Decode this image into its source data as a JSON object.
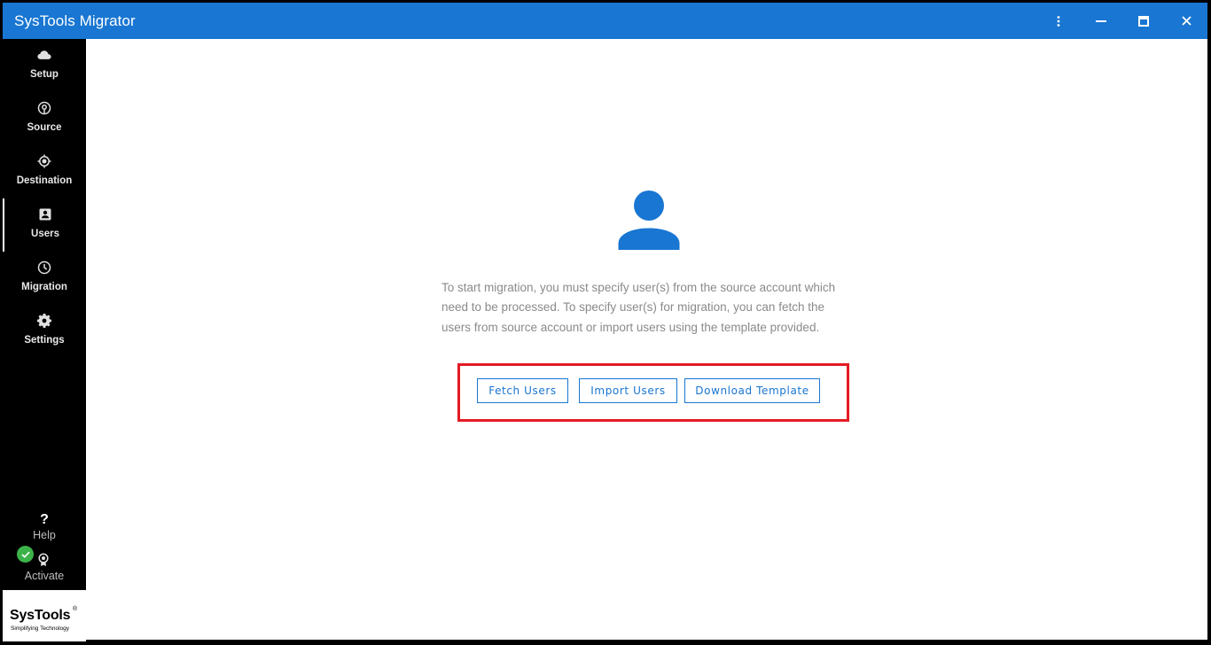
{
  "app": {
    "title": "SysTools Migrator"
  },
  "window_controls": {
    "more": "more-vert-icon",
    "minimize": "minimize-icon",
    "maximize": "maximize-icon",
    "close": "close-icon"
  },
  "sidebar": {
    "items": [
      {
        "label": "Setup",
        "icon": "cloud-icon"
      },
      {
        "label": "Source",
        "icon": "source-icon"
      },
      {
        "label": "Destination",
        "icon": "destination-icon"
      },
      {
        "label": "Users",
        "icon": "users-icon",
        "active": true
      },
      {
        "label": "Migration",
        "icon": "clock-icon"
      },
      {
        "label": "Settings",
        "icon": "gear-icon"
      }
    ],
    "help": {
      "symbol": "?",
      "label": "Help"
    },
    "activate": {
      "label": "Activate"
    },
    "logo": {
      "brand": "SysTools",
      "reg": "®",
      "tagline": "Simplifying Technology"
    }
  },
  "main": {
    "description": "To start migration, you must specify user(s) from the source account which need to be processed. To specify user(s) for migration, you can fetch the users from source account or import users using the template provided.",
    "buttons": {
      "fetch": "Fetch Users",
      "import": "Import Users",
      "download": "Download Template"
    }
  },
  "colors": {
    "accent": "#1976d2",
    "highlight": "#e31b23",
    "success": "#3cb34a"
  }
}
